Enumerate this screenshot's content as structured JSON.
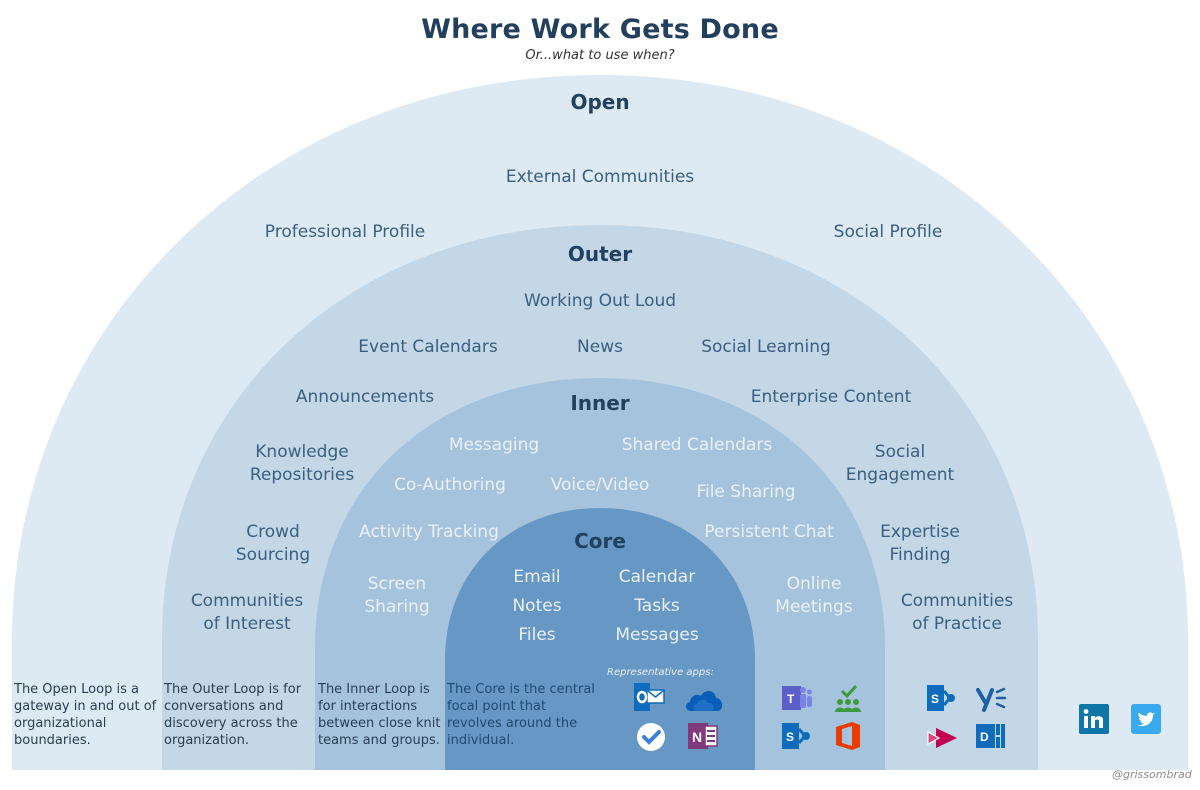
{
  "header": {
    "title": "Where Work Gets Done",
    "subtitle": "Or...what to use when?"
  },
  "colors": {
    "open": "#deeaf3",
    "outer": "#c3d7e6",
    "inner": "#a6c3dd",
    "core": "#6798c5",
    "title": "#233f5e",
    "label_dark": "#3b5f80",
    "label_light": "#e9f1f9"
  },
  "rings": {
    "open": {
      "title": "Open",
      "items": [
        "External Communities",
        "Professional Profile",
        "Social Profile"
      ],
      "description": "The Open Loop is a gateway in and out of organizational boundaries.",
      "apps": [
        {
          "name": "LinkedIn",
          "icon": "linkedin-icon"
        },
        {
          "name": "Twitter",
          "icon": "twitter-icon"
        }
      ]
    },
    "outer": {
      "title": "Outer",
      "items": [
        "Working Out Loud",
        "Event Calendars",
        "News",
        "Social Learning",
        "Announcements",
        "Enterprise Content",
        "Knowledge Repositories",
        "Social Engagement",
        "Crowd Sourcing",
        "Expertise Finding",
        "Communities of Interest",
        "Communities of Practice"
      ],
      "description": "The Outer Loop is for conversations and discovery across the organization.",
      "apps": [
        {
          "name": "SharePoint",
          "icon": "sharepoint-icon"
        },
        {
          "name": "Yammer",
          "icon": "yammer-icon"
        },
        {
          "name": "Stream",
          "icon": "stream-icon"
        },
        {
          "name": "Delve",
          "icon": "delve-icon"
        }
      ]
    },
    "inner": {
      "title": "Inner",
      "items": [
        "Messaging",
        "Shared Calendars",
        "Co-Authoring",
        "Voice/Video",
        "File Sharing",
        "Activity Tracking",
        "Persistent Chat",
        "Screen Sharing",
        "Online Meetings"
      ],
      "description": "The Inner Loop is for interactions between close knit teams and groups.",
      "apps": [
        {
          "name": "Teams",
          "icon": "teams-icon"
        },
        {
          "name": "Planner",
          "icon": "planner-icon"
        },
        {
          "name": "SharePoint",
          "icon": "sharepoint-icon"
        },
        {
          "name": "Office",
          "icon": "office-icon"
        }
      ]
    },
    "core": {
      "title": "Core",
      "items": [
        "Email",
        "Calendar",
        "Notes",
        "Tasks",
        "Files",
        "Messages"
      ],
      "description": "The Core is the central focal point that revolves around the individual.",
      "apps_label": "Representative apps:",
      "apps": [
        {
          "name": "Outlook",
          "icon": "outlook-icon"
        },
        {
          "name": "OneDrive",
          "icon": "onedrive-icon"
        },
        {
          "name": "To Do",
          "icon": "todo-icon"
        },
        {
          "name": "OneNote",
          "icon": "onenote-icon"
        }
      ]
    }
  },
  "credit": "@grissombrad"
}
